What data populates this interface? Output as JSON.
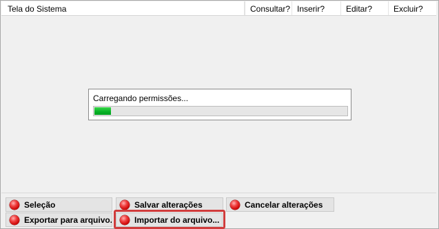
{
  "grid": {
    "columns": [
      "Tela do Sistema",
      "Consultar?",
      "Inserir?",
      "Editar?",
      "Excluir?"
    ]
  },
  "loading": {
    "message": "Carregando permissões...",
    "progress": 0.065
  },
  "buttons": {
    "selecao": "Seleção",
    "salvar": "Salvar alterações",
    "cancelar": "Cancelar alterações",
    "exportar": "Exportar para arquivo...",
    "importar": "Importar do arquivo..."
  },
  "colors": {
    "progress_fill": "#06b025",
    "button_icon": "#d40000",
    "highlight": "#d03c3c"
  },
  "icons": {
    "button_icon": "red-ball-icon"
  }
}
